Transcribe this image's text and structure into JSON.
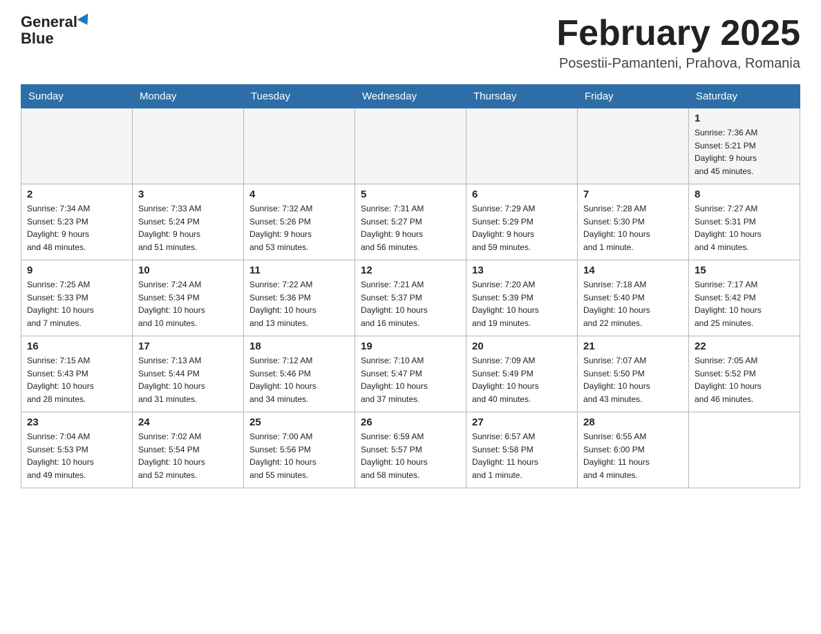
{
  "header": {
    "logo_text_general": "General",
    "logo_text_blue": "Blue",
    "month_title": "February 2025",
    "location": "Posestii-Pamanteni, Prahova, Romania"
  },
  "days_of_week": [
    "Sunday",
    "Monday",
    "Tuesday",
    "Wednesday",
    "Thursday",
    "Friday",
    "Saturday"
  ],
  "weeks": [
    [
      {
        "day": "",
        "info": ""
      },
      {
        "day": "",
        "info": ""
      },
      {
        "day": "",
        "info": ""
      },
      {
        "day": "",
        "info": ""
      },
      {
        "day": "",
        "info": ""
      },
      {
        "day": "",
        "info": ""
      },
      {
        "day": "1",
        "info": "Sunrise: 7:36 AM\nSunset: 5:21 PM\nDaylight: 9 hours\nand 45 minutes."
      }
    ],
    [
      {
        "day": "2",
        "info": "Sunrise: 7:34 AM\nSunset: 5:23 PM\nDaylight: 9 hours\nand 48 minutes."
      },
      {
        "day": "3",
        "info": "Sunrise: 7:33 AM\nSunset: 5:24 PM\nDaylight: 9 hours\nand 51 minutes."
      },
      {
        "day": "4",
        "info": "Sunrise: 7:32 AM\nSunset: 5:26 PM\nDaylight: 9 hours\nand 53 minutes."
      },
      {
        "day": "5",
        "info": "Sunrise: 7:31 AM\nSunset: 5:27 PM\nDaylight: 9 hours\nand 56 minutes."
      },
      {
        "day": "6",
        "info": "Sunrise: 7:29 AM\nSunset: 5:29 PM\nDaylight: 9 hours\nand 59 minutes."
      },
      {
        "day": "7",
        "info": "Sunrise: 7:28 AM\nSunset: 5:30 PM\nDaylight: 10 hours\nand 1 minute."
      },
      {
        "day": "8",
        "info": "Sunrise: 7:27 AM\nSunset: 5:31 PM\nDaylight: 10 hours\nand 4 minutes."
      }
    ],
    [
      {
        "day": "9",
        "info": "Sunrise: 7:25 AM\nSunset: 5:33 PM\nDaylight: 10 hours\nand 7 minutes."
      },
      {
        "day": "10",
        "info": "Sunrise: 7:24 AM\nSunset: 5:34 PM\nDaylight: 10 hours\nand 10 minutes."
      },
      {
        "day": "11",
        "info": "Sunrise: 7:22 AM\nSunset: 5:36 PM\nDaylight: 10 hours\nand 13 minutes."
      },
      {
        "day": "12",
        "info": "Sunrise: 7:21 AM\nSunset: 5:37 PM\nDaylight: 10 hours\nand 16 minutes."
      },
      {
        "day": "13",
        "info": "Sunrise: 7:20 AM\nSunset: 5:39 PM\nDaylight: 10 hours\nand 19 minutes."
      },
      {
        "day": "14",
        "info": "Sunrise: 7:18 AM\nSunset: 5:40 PM\nDaylight: 10 hours\nand 22 minutes."
      },
      {
        "day": "15",
        "info": "Sunrise: 7:17 AM\nSunset: 5:42 PM\nDaylight: 10 hours\nand 25 minutes."
      }
    ],
    [
      {
        "day": "16",
        "info": "Sunrise: 7:15 AM\nSunset: 5:43 PM\nDaylight: 10 hours\nand 28 minutes."
      },
      {
        "day": "17",
        "info": "Sunrise: 7:13 AM\nSunset: 5:44 PM\nDaylight: 10 hours\nand 31 minutes."
      },
      {
        "day": "18",
        "info": "Sunrise: 7:12 AM\nSunset: 5:46 PM\nDaylight: 10 hours\nand 34 minutes."
      },
      {
        "day": "19",
        "info": "Sunrise: 7:10 AM\nSunset: 5:47 PM\nDaylight: 10 hours\nand 37 minutes."
      },
      {
        "day": "20",
        "info": "Sunrise: 7:09 AM\nSunset: 5:49 PM\nDaylight: 10 hours\nand 40 minutes."
      },
      {
        "day": "21",
        "info": "Sunrise: 7:07 AM\nSunset: 5:50 PM\nDaylight: 10 hours\nand 43 minutes."
      },
      {
        "day": "22",
        "info": "Sunrise: 7:05 AM\nSunset: 5:52 PM\nDaylight: 10 hours\nand 46 minutes."
      }
    ],
    [
      {
        "day": "23",
        "info": "Sunrise: 7:04 AM\nSunset: 5:53 PM\nDaylight: 10 hours\nand 49 minutes."
      },
      {
        "day": "24",
        "info": "Sunrise: 7:02 AM\nSunset: 5:54 PM\nDaylight: 10 hours\nand 52 minutes."
      },
      {
        "day": "25",
        "info": "Sunrise: 7:00 AM\nSunset: 5:56 PM\nDaylight: 10 hours\nand 55 minutes."
      },
      {
        "day": "26",
        "info": "Sunrise: 6:59 AM\nSunset: 5:57 PM\nDaylight: 10 hours\nand 58 minutes."
      },
      {
        "day": "27",
        "info": "Sunrise: 6:57 AM\nSunset: 5:58 PM\nDaylight: 11 hours\nand 1 minute."
      },
      {
        "day": "28",
        "info": "Sunrise: 6:55 AM\nSunset: 6:00 PM\nDaylight: 11 hours\nand 4 minutes."
      },
      {
        "day": "",
        "info": ""
      }
    ]
  ]
}
